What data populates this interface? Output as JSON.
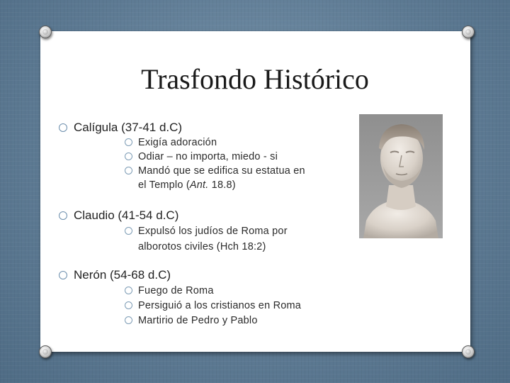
{
  "slide": {
    "title": "Trasfondo Histórico",
    "sections": [
      {
        "heading": "Calígula (37-41 d.C)",
        "items": [
          "Exigía adoración",
          "Odiar – no importa, miedo - si",
          "Mandó que se edifica su estatua en",
          "el Templo (",
          "Ant.",
          " 18.8)"
        ]
      },
      {
        "heading": "Claudio (41-54 d.C)",
        "items": [
          "Expulsó los judíos de Roma por",
          "alborotos civiles (Hch 18:2)"
        ]
      },
      {
        "heading": "Nerón (54-68 d.C)",
        "items": [
          "Fuego de Roma",
          "Persiguió a los cristianos en Roma",
          "Martirio de Pedro y Pablo"
        ]
      }
    ],
    "image_subject": "marble-bust-portrait"
  },
  "colors": {
    "background": "#5f7c95",
    "card": "#ffffff",
    "bullet": "#7d9cb5",
    "text": "#222222"
  }
}
